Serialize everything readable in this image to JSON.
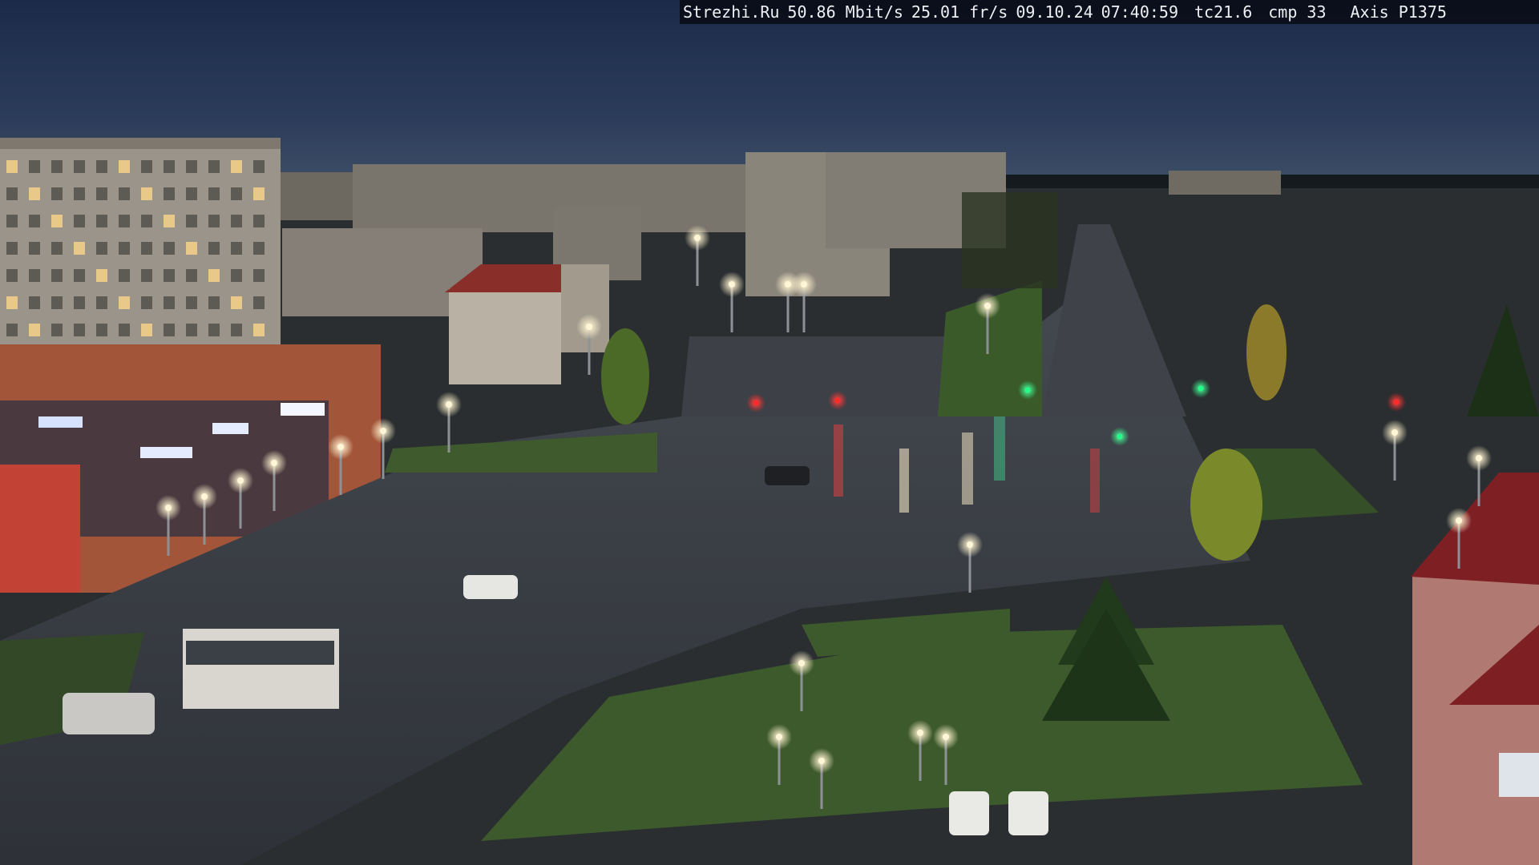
{
  "overlay": {
    "site": "Strezhi.Ru",
    "bitrate": "50.86 Mbit/s",
    "framerate": "25.01 fr/s",
    "date": "09.10.24",
    "time": "07:40:59",
    "tc": "tc21.6",
    "cmp": "cmp 33",
    "camera": "Axis P1375"
  },
  "colors": {
    "sky_top": "#1c2c4d",
    "sky_horizon": "#3b4d66",
    "ground": "#3a3e44",
    "grass": "#3d5a2c",
    "lamp": "#fff6d8",
    "signal_red": "#ff2a2a",
    "signal_green": "#22ff88",
    "store_sign": "#dfe8ff"
  }
}
